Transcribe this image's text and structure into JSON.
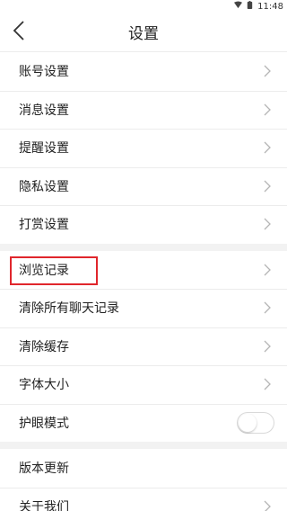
{
  "status_bar": {
    "time": "11:48"
  },
  "header": {
    "title": "设置"
  },
  "groups": [
    {
      "rows": [
        {
          "label": "账号设置"
        },
        {
          "label": "消息设置"
        },
        {
          "label": "提醒设置"
        },
        {
          "label": "隐私设置"
        },
        {
          "label": "打赏设置"
        }
      ]
    },
    {
      "rows": [
        {
          "label": "浏览记录",
          "highlighted": true
        },
        {
          "label": "清除所有聊天记录"
        },
        {
          "label": "清除缓存"
        },
        {
          "label": "字体大小"
        },
        {
          "label": "护眼模式",
          "control": "toggle",
          "toggle_on": false
        }
      ]
    },
    {
      "rows": [
        {
          "label": "版本更新"
        },
        {
          "label": "关于我们"
        }
      ]
    }
  ],
  "colors": {
    "highlight_border": "#e0262c",
    "band": "#f2f2f2"
  }
}
